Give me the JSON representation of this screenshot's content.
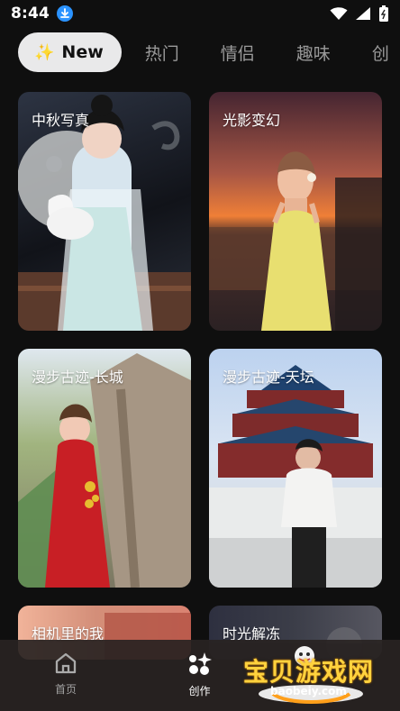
{
  "status": {
    "time": "8:44"
  },
  "tabs": {
    "active": "New",
    "items": [
      "热门",
      "情侣",
      "趣味",
      "创"
    ]
  },
  "cards": [
    {
      "label": "中秋写真"
    },
    {
      "label": "光影变幻"
    },
    {
      "label": "漫步古迹-长城"
    },
    {
      "label": "漫步古迹-天坛"
    },
    {
      "label": "相机里的我"
    },
    {
      "label": "时光解冻"
    }
  ],
  "nav": {
    "home_label": "首页",
    "create_label": "创作"
  },
  "watermark": {
    "title": "宝贝游戏网",
    "url": "baobeiy.com"
  }
}
